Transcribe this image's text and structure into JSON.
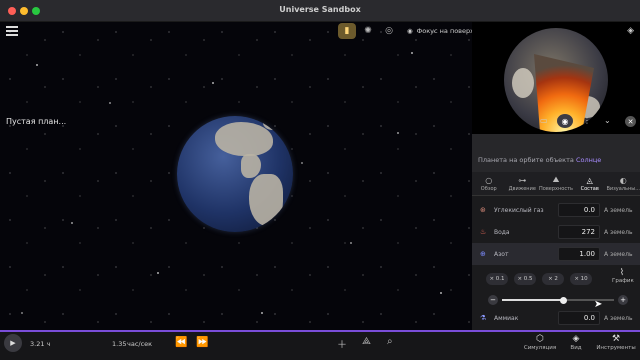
{
  "window": {
    "title": "Universe Sandbox"
  },
  "toolbar": {
    "focus_label": "Фокус на поверхности",
    "icons": [
      "flashlight-icon",
      "sun-icon",
      "orbit-icon",
      "focus-icon"
    ]
  },
  "panel": {
    "object_name": "Пустая план...",
    "orbit_prefix": "Планета на орбите объекта",
    "orbit_target": "Солнце",
    "tabs": [
      {
        "label": "Обзор",
        "icon": "overview-icon"
      },
      {
        "label": "Движение",
        "icon": "motion-icon"
      },
      {
        "label": "Поверхность",
        "icon": "surface-icon"
      },
      {
        "label": "Состав",
        "icon": "composition-icon",
        "active": true
      },
      {
        "label": "Визуальны...",
        "icon": "visuals-icon"
      }
    ],
    "rows": [
      {
        "name": "Углекислый газ",
        "value": "0.0",
        "unit": "А земель",
        "color": "#d98b7a"
      },
      {
        "name": "Вода",
        "value": "272",
        "unit": "А земель",
        "color": "#e86a5a"
      },
      {
        "name": "Азот",
        "value": "1.00",
        "unit": "А земель",
        "color": "#7d8cff",
        "selected": true
      },
      {
        "name": "Аммиак",
        "value": "0.0",
        "unit": "А земель",
        "color": "#8c9aff"
      }
    ],
    "multipliers": [
      "× 0.1",
      "× 0.5",
      "× 2",
      "× 10"
    ],
    "graph_label": "График",
    "slider_position": 0.55
  },
  "bottom": {
    "elapsed": "3.21 ч",
    "rate": "1.35",
    "rate_unit": "час/сек",
    "tools": [
      {
        "label": "Симуляция",
        "icon": "simulation-icon"
      },
      {
        "label": "Вид",
        "icon": "view-icon"
      },
      {
        "label": "Инструменты",
        "icon": "tools-icon"
      }
    ]
  }
}
